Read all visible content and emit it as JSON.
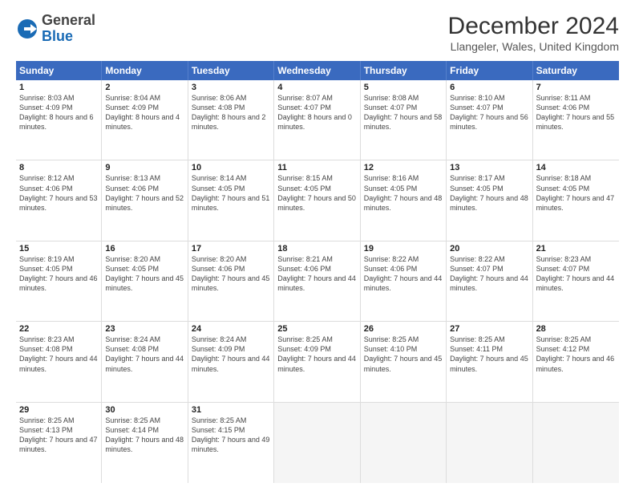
{
  "logo": {
    "general": "General",
    "blue": "Blue"
  },
  "title": "December 2024",
  "location": "Llangeler, Wales, United Kingdom",
  "header": {
    "days": [
      "Sunday",
      "Monday",
      "Tuesday",
      "Wednesday",
      "Thursday",
      "Friday",
      "Saturday"
    ]
  },
  "weeks": [
    [
      {
        "day": "1",
        "sunrise": "8:03 AM",
        "sunset": "4:09 PM",
        "daylight": "8 hours and 6 minutes."
      },
      {
        "day": "2",
        "sunrise": "8:04 AM",
        "sunset": "4:09 PM",
        "daylight": "8 hours and 4 minutes."
      },
      {
        "day": "3",
        "sunrise": "8:06 AM",
        "sunset": "4:08 PM",
        "daylight": "8 hours and 2 minutes."
      },
      {
        "day": "4",
        "sunrise": "8:07 AM",
        "sunset": "4:07 PM",
        "daylight": "8 hours and 0 minutes."
      },
      {
        "day": "5",
        "sunrise": "8:08 AM",
        "sunset": "4:07 PM",
        "daylight": "7 hours and 58 minutes."
      },
      {
        "day": "6",
        "sunrise": "8:10 AM",
        "sunset": "4:07 PM",
        "daylight": "7 hours and 56 minutes."
      },
      {
        "day": "7",
        "sunrise": "8:11 AM",
        "sunset": "4:06 PM",
        "daylight": "7 hours and 55 minutes."
      }
    ],
    [
      {
        "day": "8",
        "sunrise": "8:12 AM",
        "sunset": "4:06 PM",
        "daylight": "7 hours and 53 minutes."
      },
      {
        "day": "9",
        "sunrise": "8:13 AM",
        "sunset": "4:06 PM",
        "daylight": "7 hours and 52 minutes."
      },
      {
        "day": "10",
        "sunrise": "8:14 AM",
        "sunset": "4:05 PM",
        "daylight": "7 hours and 51 minutes."
      },
      {
        "day": "11",
        "sunrise": "8:15 AM",
        "sunset": "4:05 PM",
        "daylight": "7 hours and 50 minutes."
      },
      {
        "day": "12",
        "sunrise": "8:16 AM",
        "sunset": "4:05 PM",
        "daylight": "7 hours and 48 minutes."
      },
      {
        "day": "13",
        "sunrise": "8:17 AM",
        "sunset": "4:05 PM",
        "daylight": "7 hours and 48 minutes."
      },
      {
        "day": "14",
        "sunrise": "8:18 AM",
        "sunset": "4:05 PM",
        "daylight": "7 hours and 47 minutes."
      }
    ],
    [
      {
        "day": "15",
        "sunrise": "8:19 AM",
        "sunset": "4:05 PM",
        "daylight": "7 hours and 46 minutes."
      },
      {
        "day": "16",
        "sunrise": "8:20 AM",
        "sunset": "4:05 PM",
        "daylight": "7 hours and 45 minutes."
      },
      {
        "day": "17",
        "sunrise": "8:20 AM",
        "sunset": "4:06 PM",
        "daylight": "7 hours and 45 minutes."
      },
      {
        "day": "18",
        "sunrise": "8:21 AM",
        "sunset": "4:06 PM",
        "daylight": "7 hours and 44 minutes."
      },
      {
        "day": "19",
        "sunrise": "8:22 AM",
        "sunset": "4:06 PM",
        "daylight": "7 hours and 44 minutes."
      },
      {
        "day": "20",
        "sunrise": "8:22 AM",
        "sunset": "4:07 PM",
        "daylight": "7 hours and 44 minutes."
      },
      {
        "day": "21",
        "sunrise": "8:23 AM",
        "sunset": "4:07 PM",
        "daylight": "7 hours and 44 minutes."
      }
    ],
    [
      {
        "day": "22",
        "sunrise": "8:23 AM",
        "sunset": "4:08 PM",
        "daylight": "7 hours and 44 minutes."
      },
      {
        "day": "23",
        "sunrise": "8:24 AM",
        "sunset": "4:08 PM",
        "daylight": "7 hours and 44 minutes."
      },
      {
        "day": "24",
        "sunrise": "8:24 AM",
        "sunset": "4:09 PM",
        "daylight": "7 hours and 44 minutes."
      },
      {
        "day": "25",
        "sunrise": "8:25 AM",
        "sunset": "4:09 PM",
        "daylight": "7 hours and 44 minutes."
      },
      {
        "day": "26",
        "sunrise": "8:25 AM",
        "sunset": "4:10 PM",
        "daylight": "7 hours and 45 minutes."
      },
      {
        "day": "27",
        "sunrise": "8:25 AM",
        "sunset": "4:11 PM",
        "daylight": "7 hours and 45 minutes."
      },
      {
        "day": "28",
        "sunrise": "8:25 AM",
        "sunset": "4:12 PM",
        "daylight": "7 hours and 46 minutes."
      }
    ],
    [
      {
        "day": "29",
        "sunrise": "8:25 AM",
        "sunset": "4:13 PM",
        "daylight": "7 hours and 47 minutes."
      },
      {
        "day": "30",
        "sunrise": "8:25 AM",
        "sunset": "4:14 PM",
        "daylight": "7 hours and 48 minutes."
      },
      {
        "day": "31",
        "sunrise": "8:25 AM",
        "sunset": "4:15 PM",
        "daylight": "7 hours and 49 minutes."
      },
      null,
      null,
      null,
      null
    ]
  ],
  "labels": {
    "sunrise": "Sunrise:",
    "sunset": "Sunset:",
    "daylight": "Daylight:"
  }
}
